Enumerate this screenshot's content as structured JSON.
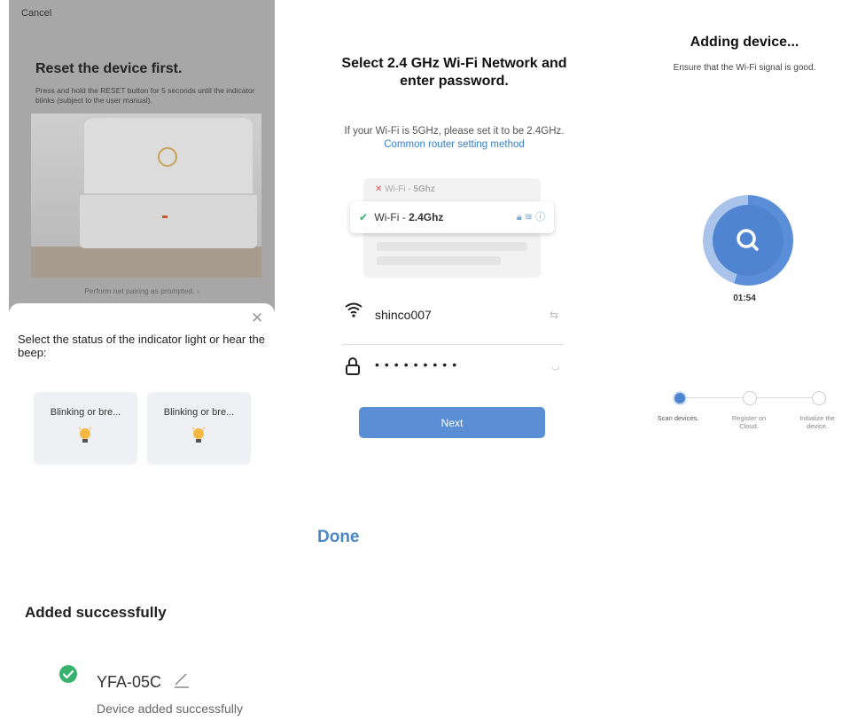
{
  "panel1": {
    "cancel_label": "Cancel",
    "title": "Reset the device first.",
    "description": "Press and hold the RESET button for 5 seconds until the indicator blinks (subject to the user manual).",
    "prompt_link": "Perform net pairing as prompted. ›",
    "sheet": {
      "question": "Select the status of the indicator light or hear the beep:",
      "options": [
        {
          "label": "Blinking or bre..."
        },
        {
          "label": "Blinking or bre..."
        }
      ]
    }
  },
  "panel2": {
    "title": "Select 2.4 GHz Wi-Fi Network and enter password.",
    "hint_prefix": "If your Wi-Fi is 5GHz, please set it to be 2.4GHz.",
    "hint_link": "Common router setting method",
    "wifi_5g_prefix": "Wi-Fi - ",
    "wifi_5g_band": "5Ghz",
    "wifi_24g_prefix": "Wi-Fi - ",
    "wifi_24g_band": "2.4Ghz",
    "ssid_value": "shinco007",
    "password_mask": "•••••••••",
    "next_label": "Next"
  },
  "panel3": {
    "title": "Adding device...",
    "subtitle": "Ensure that the Wi-Fi signal is good.",
    "timer": "01:54",
    "progress_fraction": 0.55,
    "steps": [
      {
        "label": "Scan devices.",
        "state": "active"
      },
      {
        "label": "Register on Cloud.",
        "state": "pending"
      },
      {
        "label": "Initialize the device.",
        "state": "pending"
      }
    ]
  },
  "bottom": {
    "done_label": "Done",
    "added_title": "Added successfully",
    "device_name": "YFA-05C",
    "device_status": "Device added successfully"
  },
  "colors": {
    "accent": "#4a86c8",
    "button": "#5a8fd6",
    "success": "#37b26c"
  }
}
